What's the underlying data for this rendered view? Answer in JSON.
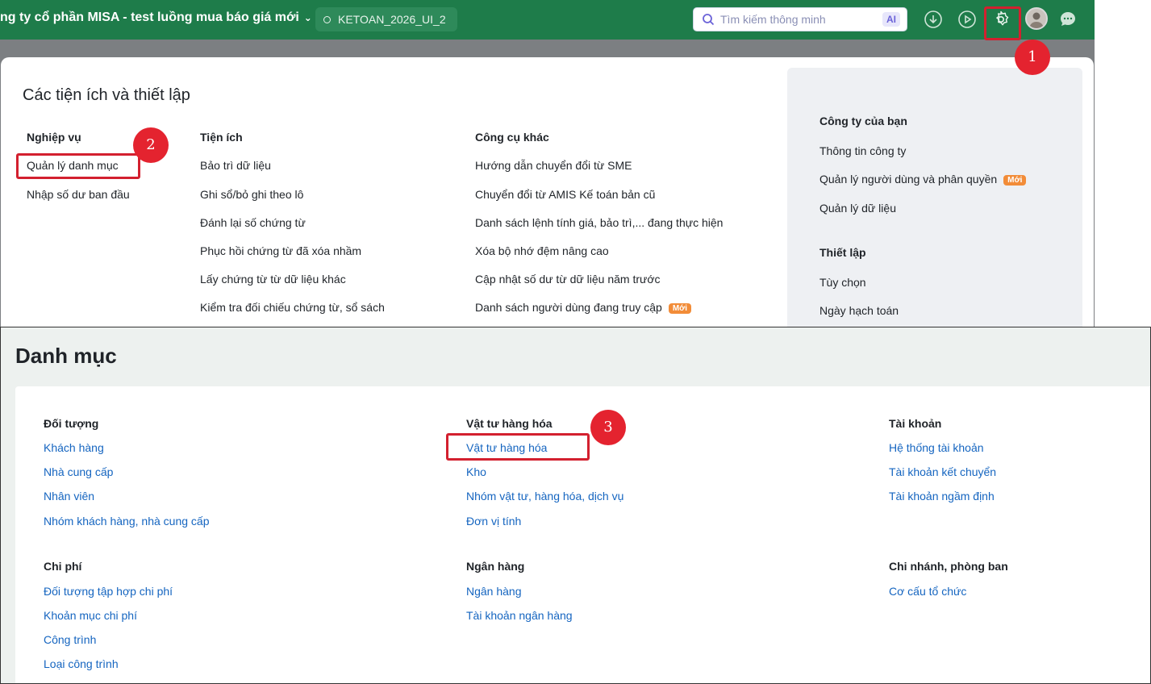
{
  "topbar": {
    "company_name": "ng ty cổ phần MISA - test luồng mua báo giá mới",
    "database": "KETOAN_2026_UI_2",
    "search_placeholder": "Tìm kiếm thông minh",
    "ai_badge": "AI"
  },
  "settings_modal": {
    "title": "Các tiện ích và thiết lập",
    "nghiep_vu": {
      "heading": "Nghiệp vụ",
      "items": [
        "Quản lý danh mục",
        "Nhập số dư ban đầu"
      ]
    },
    "tien_ich": {
      "heading": "Tiện ích",
      "items": [
        "Bảo trì dữ liệu",
        "Ghi sổ/bỏ ghi theo lô",
        "Đánh lại số chứng từ",
        "Phục hồi chứng từ đã xóa nhầm",
        "Lấy chứng từ từ dữ liệu khác",
        "Kiểm tra đối chiếu chứng từ, sổ sách"
      ]
    },
    "cong_cu_khac": {
      "heading": "Công cụ khác",
      "items": [
        "Hướng dẫn chuyển đổi từ SME",
        "Chuyển đổi từ AMIS Kế toán bản cũ",
        "Danh sách lệnh tính giá, bảo trì,... đang thực hiện",
        "Xóa bộ nhớ đệm nâng cao",
        "Cập nhật số dư từ dữ liệu năm trước",
        "Danh sách người dùng đang truy cập"
      ],
      "new_badge": "Mới"
    },
    "side": {
      "company_heading": "Công ty của bạn",
      "company_items": [
        "Thông tin công ty",
        "Quản lý người dùng và phân quyền",
        "Quản lý dữ liệu"
      ],
      "new_badge": "Mới",
      "settings_heading": "Thiết lập",
      "settings_items": [
        "Tùy chọn",
        "Ngày hạch toán"
      ]
    }
  },
  "steps": [
    "1",
    "2",
    "3"
  ],
  "danh_muc": {
    "title": "Danh mục",
    "doi_tuong": {
      "heading": "Đối tượng",
      "items": [
        "Khách hàng",
        "Nhà cung cấp",
        "Nhân viên",
        "Nhóm khách hàng, nhà cung cấp"
      ]
    },
    "vat_tu": {
      "heading": "Vật tư hàng hóa",
      "items": [
        "Vật tư hàng hóa",
        "Kho",
        "Nhóm vật tư, hàng hóa, dịch vụ",
        "Đơn vị tính"
      ]
    },
    "tai_khoan": {
      "heading": "Tài khoản",
      "items": [
        "Hệ thống tài khoản",
        "Tài khoản kết chuyển",
        "Tài khoản ngầm định"
      ]
    },
    "chi_phi": {
      "heading": "Chi phí",
      "items": [
        "Đối tượng tập hợp chi phí",
        "Khoản mục chi phí",
        "Công trình",
        "Loại công trình"
      ]
    },
    "ngan_hang": {
      "heading": "Ngân hàng",
      "items": [
        "Ngân hàng",
        "Tài khoản ngân hàng"
      ]
    },
    "chi_nhanh": {
      "heading": "Chi nhánh, phòng ban",
      "items": [
        "Cơ cấu tổ chức"
      ]
    }
  },
  "colors": {
    "topbar": "#1e7c4a",
    "highlight": "#d3202f",
    "link": "#1565c0",
    "badge": "#f28c38"
  }
}
